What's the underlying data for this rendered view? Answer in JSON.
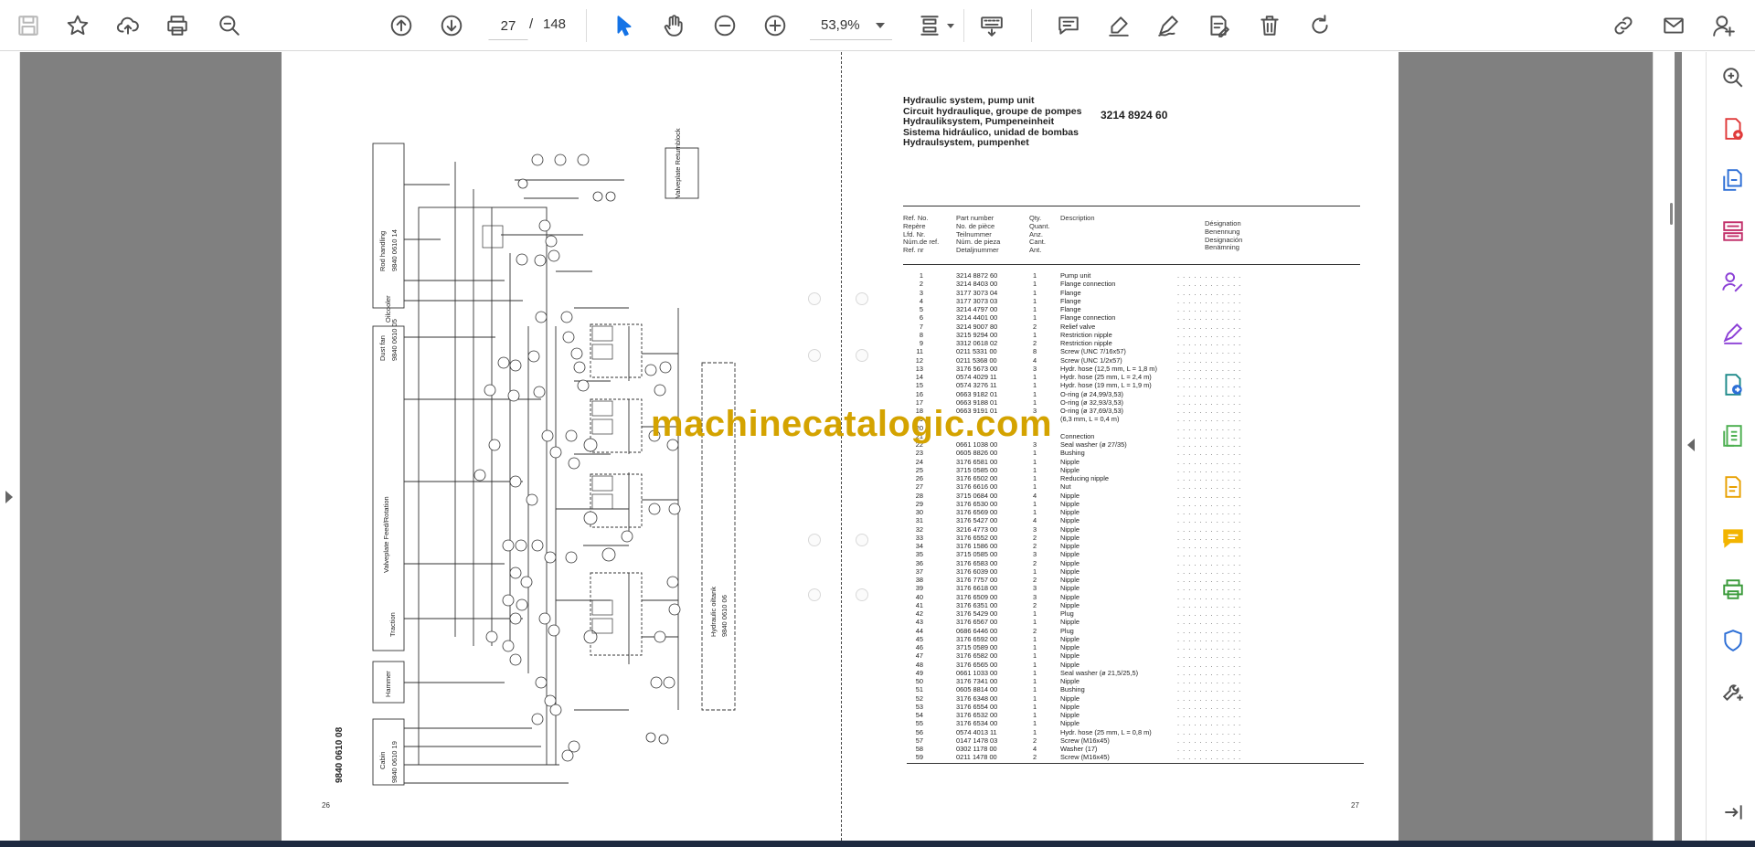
{
  "toolbar": {
    "current_page": "27",
    "page_separator": "/",
    "total_pages": "148",
    "zoom": "53,9%"
  },
  "watermark": "machinecatalogic.com",
  "left_page": {
    "page_number": "26",
    "drawing_number": "9840 0610 08",
    "labels": {
      "rod_handling": "Rod handling",
      "rod_handling_no": "9840 0610 14",
      "oilcooler": "Oilcooler",
      "dust_fan": "Dust fan",
      "dust_fan_no": "9840 0610 05",
      "valveplate_feed": "Valveplate Feed/Rotation",
      "traction": "Traction",
      "hammer": "Hammer",
      "cabin": "Cabin",
      "cabin_no": "9840 0610 19",
      "hydraulic_oiltank": "Hydraulic oiltank",
      "hydraulic_oiltank_no": "9840 0610 06",
      "valveplate_return": "Valveplate Returnblock"
    }
  },
  "right_page": {
    "page_number": "27",
    "title_lines": [
      "Hydraulic system, pump unit",
      "Circuit hydraulique, groupe de pompes",
      "Hydrauliksystem, Pumpeneinheit",
      "Sistema hidráulico, unidad de bombas",
      "Hydraulsystem, pumpenhet"
    ],
    "part_number": "3214 8924 60",
    "headers": {
      "ref": [
        "Ref. No.",
        "Repère",
        "Lfd. Nr.",
        "Núm.de ref.",
        "Ref. nr"
      ],
      "part": [
        "Part number",
        "No. de pièce",
        "Teilnummer",
        "Núm. de pieza",
        "Detaljnummer"
      ],
      "qty": [
        "Qty.",
        "Quant.",
        "Anz.",
        "Cant.",
        "Ant."
      ],
      "desc": [
        "Description"
      ],
      "desig": [
        "Désignation",
        "Benennung",
        "Designación",
        "Benämning"
      ]
    },
    "rows": [
      {
        "ref": "1",
        "part": "3214 8872 60",
        "qty": "1",
        "desc": "Pump unit"
      },
      {
        "ref": "2",
        "part": "3214 8403 00",
        "qty": "1",
        "desc": "Flange connection"
      },
      {
        "ref": "3",
        "part": "3177 3073 04",
        "qty": "1",
        "desc": "Flange"
      },
      {
        "ref": "4",
        "part": "3177 3073 03",
        "qty": "1",
        "desc": "Flange"
      },
      {
        "ref": "5",
        "part": "3214 4797 00",
        "qty": "1",
        "desc": "Flange"
      },
      {
        "ref": "6",
        "part": "3214 4401 00",
        "qty": "1",
        "desc": "Flange connection"
      },
      {
        "ref": "7",
        "part": "3214 9007 80",
        "qty": "2",
        "desc": "Relief valve"
      },
      {
        "ref": "8",
        "part": "3215 9294 00",
        "qty": "1",
        "desc": "Restriction nipple"
      },
      {
        "ref": "9",
        "part": "3312 0618 02",
        "qty": "2",
        "desc": "Restriction nipple"
      },
      {
        "ref": "11",
        "part": "0211 5331 00",
        "qty": "8",
        "desc": "Screw (UNC 7/16x57)"
      },
      {
        "ref": "12",
        "part": "0211 5368 00",
        "qty": "4",
        "desc": "Screw (UNC 1/2x57)"
      },
      {
        "ref": "13",
        "part": "3176 5673 00",
        "qty": "3",
        "desc": "Hydr. hose (12,5 mm, L = 1,8 m)"
      },
      {
        "ref": "14",
        "part": "0574 4029 11",
        "qty": "1",
        "desc": "Hydr. hose (25 mm, L = 2,4 m)"
      },
      {
        "ref": "15",
        "part": "0574 3276 11",
        "qty": "1",
        "desc": "Hydr. hose (19 mm, L = 1,9 m)"
      },
      {
        "ref": "16",
        "part": "0663 9182 01",
        "qty": "1",
        "desc": "O-ring (ø 24,99/3,53)"
      },
      {
        "ref": "17",
        "part": "0663 9188 01",
        "qty": "1",
        "desc": "O-ring (ø 32,93/3,53)"
      },
      {
        "ref": "18",
        "part": "0663 9191 01",
        "qty": "3",
        "desc": "O-ring (ø 37,69/3,53)"
      },
      {
        "ref": "19",
        "part": "",
        "qty": "",
        "desc": "(6,3 mm, L = 0,4 m)"
      },
      {
        "ref": "20",
        "part": "",
        "qty": "",
        "desc": ""
      },
      {
        "ref": "21",
        "part": "",
        "qty": "",
        "desc": "Connection"
      },
      {
        "ref": "22",
        "part": "0661 1038 00",
        "qty": "3",
        "desc": "Seal washer (ø 27/35)"
      },
      {
        "ref": "23",
        "part": "0605 8826 00",
        "qty": "1",
        "desc": "Bushing"
      },
      {
        "ref": "24",
        "part": "3176 6581 00",
        "qty": "1",
        "desc": "Nipple"
      },
      {
        "ref": "25",
        "part": "3715 0585 00",
        "qty": "1",
        "desc": "Nipple"
      },
      {
        "ref": "26",
        "part": "3176 6502 00",
        "qty": "1",
        "desc": "Reducing nipple"
      },
      {
        "ref": "27",
        "part": "3176 6616 00",
        "qty": "1",
        "desc": "Nut"
      },
      {
        "ref": "28",
        "part": "3715 0684 00",
        "qty": "4",
        "desc": "Nipple"
      },
      {
        "ref": "29",
        "part": "3176 6530 00",
        "qty": "1",
        "desc": "Nipple"
      },
      {
        "ref": "30",
        "part": "3176 6569 00",
        "qty": "1",
        "desc": "Nipple"
      },
      {
        "ref": "31",
        "part": "3176 5427 00",
        "qty": "4",
        "desc": "Nipple"
      },
      {
        "ref": "32",
        "part": "3216 4773 00",
        "qty": "3",
        "desc": "Nipple"
      },
      {
        "ref": "33",
        "part": "3176 6552 00",
        "qty": "2",
        "desc": "Nipple"
      },
      {
        "ref": "34",
        "part": "3176 1586 00",
        "qty": "2",
        "desc": "Nipple"
      },
      {
        "ref": "35",
        "part": "3715 0585 00",
        "qty": "3",
        "desc": "Nipple"
      },
      {
        "ref": "36",
        "part": "3176 6583 00",
        "qty": "2",
        "desc": "Nipple"
      },
      {
        "ref": "37",
        "part": "3176 6039 00",
        "qty": "1",
        "desc": "Nipple"
      },
      {
        "ref": "38",
        "part": "3176 7757 00",
        "qty": "2",
        "desc": "Nipple"
      },
      {
        "ref": "39",
        "part": "3176 6618 00",
        "qty": "3",
        "desc": "Nipple"
      },
      {
        "ref": "40",
        "part": "3176 6509 00",
        "qty": "3",
        "desc": "Nipple"
      },
      {
        "ref": "41",
        "part": "3176 6351 00",
        "qty": "2",
        "desc": "Nipple"
      },
      {
        "ref": "42",
        "part": "3176 5429 00",
        "qty": "1",
        "desc": "Plug"
      },
      {
        "ref": "43",
        "part": "3176 6567 00",
        "qty": "1",
        "desc": "Nipple"
      },
      {
        "ref": "44",
        "part": "0686 6446 00",
        "qty": "2",
        "desc": "Plug"
      },
      {
        "ref": "45",
        "part": "3176 6592 00",
        "qty": "1",
        "desc": "Nipple"
      },
      {
        "ref": "46",
        "part": "3715 0589 00",
        "qty": "1",
        "desc": "Nipple"
      },
      {
        "ref": "47",
        "part": "3176 6582 00",
        "qty": "1",
        "desc": "Nipple"
      },
      {
        "ref": "48",
        "part": "3176 6565 00",
        "qty": "1",
        "desc": "Nipple"
      },
      {
        "ref": "49",
        "part": "0661 1033 00",
        "qty": "1",
        "desc": "Seal washer (ø 21,5/25,5)"
      },
      {
        "ref": "50",
        "part": "3176 7341 00",
        "qty": "1",
        "desc": "Nipple"
      },
      {
        "ref": "51",
        "part": "0605 8814 00",
        "qty": "1",
        "desc": "Bushing"
      },
      {
        "ref": "52",
        "part": "3176 6348 00",
        "qty": "1",
        "desc": "Nipple"
      },
      {
        "ref": "53",
        "part": "3176 6554 00",
        "qty": "1",
        "desc": "Nipple"
      },
      {
        "ref": "54",
        "part": "3176 6532 00",
        "qty": "1",
        "desc": "Nipple"
      },
      {
        "ref": "55",
        "part": "3176 6534 00",
        "qty": "1",
        "desc": "Nipple"
      },
      {
        "ref": "56",
        "part": "0574 4013 11",
        "qty": "1",
        "desc": "Hydr. hose (25 mm, L = 0,8 m)"
      },
      {
        "ref": "57",
        "part": "0147 1478 03",
        "qty": "2",
        "desc": "Screw (M16x45)"
      },
      {
        "ref": "58",
        "part": "0302 1178 00",
        "qty": "4",
        "desc": "Washer (17)"
      },
      {
        "ref": "59",
        "part": "0211 1478 00",
        "qty": "2",
        "desc": "Screw (M16x45)"
      }
    ]
  },
  "sidebar_icons": [
    "search-zoom-icon",
    "export-pdf-icon",
    "create-pdf-icon",
    "organize-pages-icon",
    "request-signature-icon",
    "fill-sign-icon",
    "export-icon",
    "compress-icon",
    "edit-pdf-icon",
    "comment-icon",
    "print-production-icon",
    "protect-icon",
    "more-tools-icon",
    "collapse-panel-icon"
  ],
  "colors": {
    "accent": "#1473e6",
    "viewer_bg": "#808080",
    "watermark": "#d4a300"
  }
}
